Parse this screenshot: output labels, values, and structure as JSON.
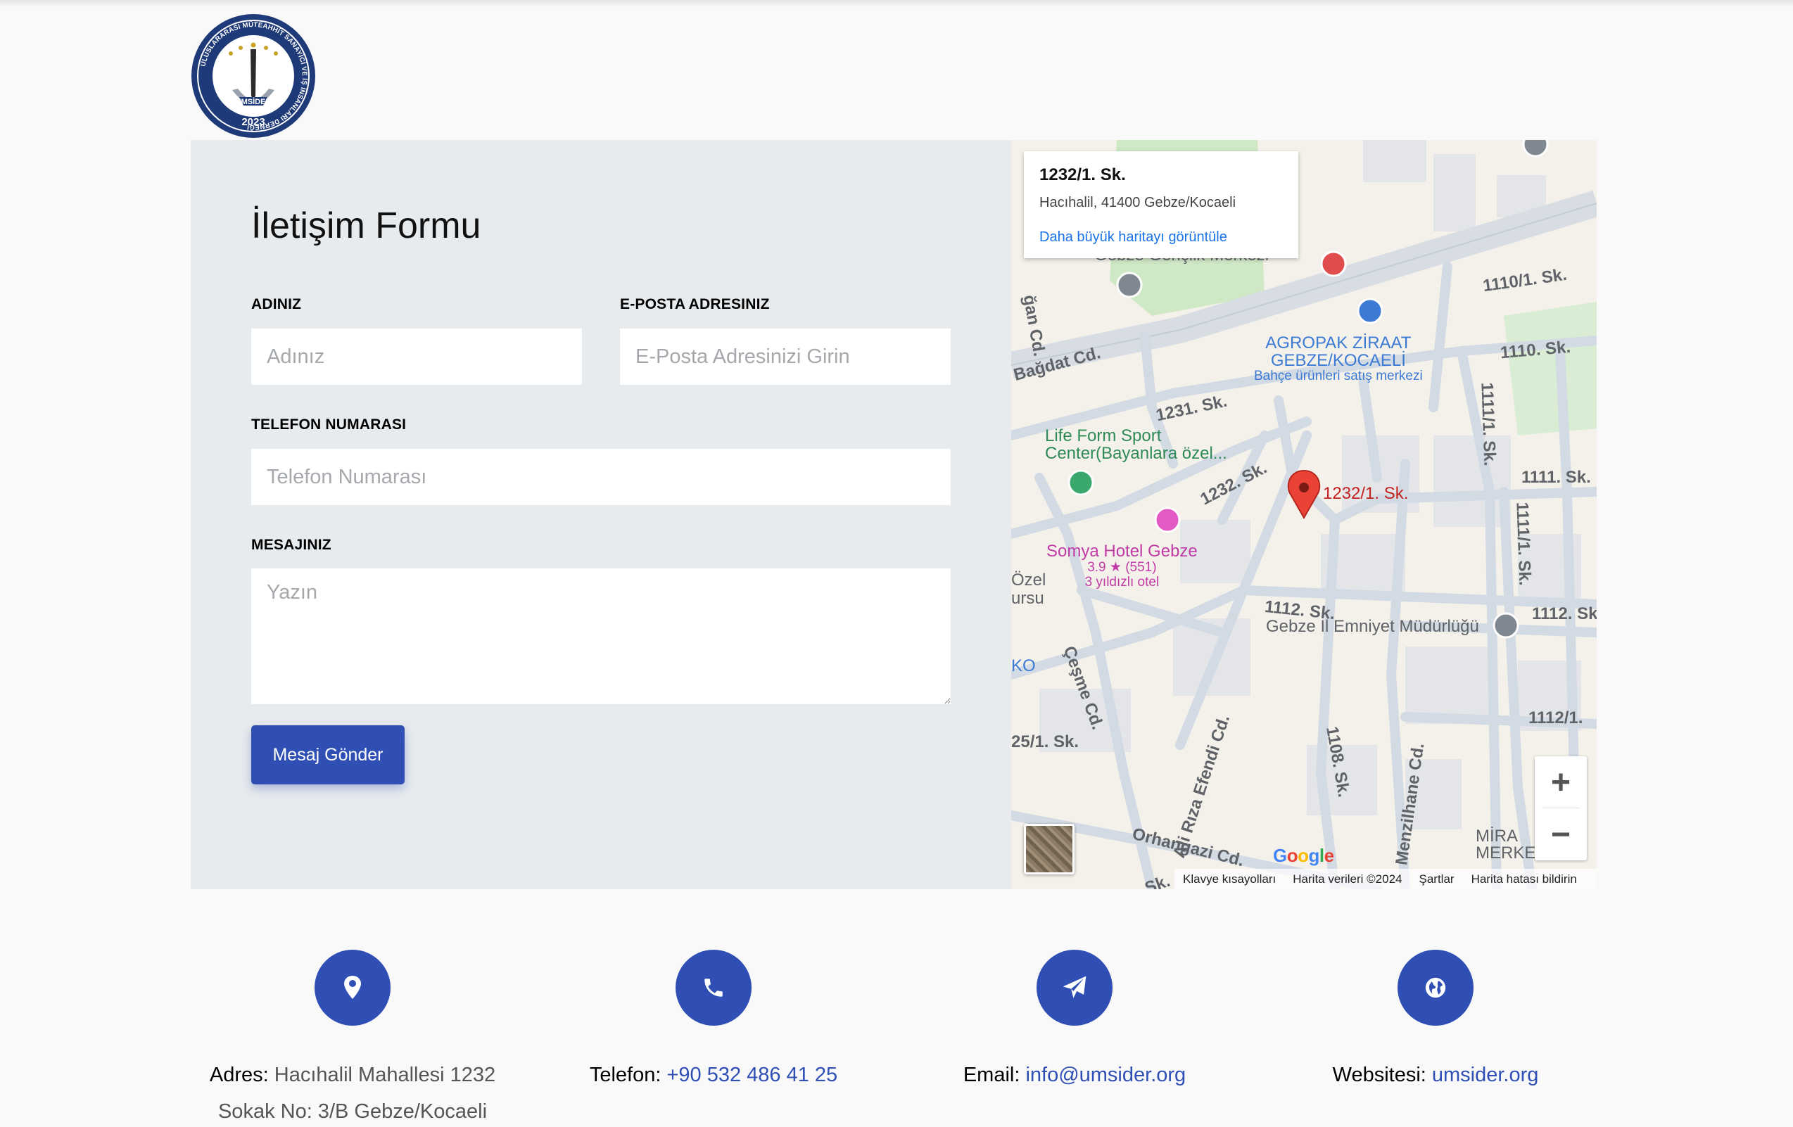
{
  "logo": {
    "ring_text": "ULUSLARARASI MÜTEAHHİT SANAYİCİ VE İŞ İNSANLARI DERNEĞİ",
    "name": "UMSİDER",
    "year": "2023"
  },
  "form": {
    "title": "İletişim Formu",
    "name_label": "ADINIZ",
    "name_placeholder": "Adınız",
    "email_label": "E-POSTA ADRESINIZ",
    "email_placeholder": "E-Posta Adresinizi Girin",
    "phone_label": "TELEFON NUMARASI",
    "phone_placeholder": "Telefon Numarası",
    "message_label": "MESAJINIZ",
    "message_placeholder": "Yazın",
    "submit_label": "Mesaj Gönder"
  },
  "map": {
    "card_title": "1232/1. Sk.",
    "card_address": "Hacıhalil, 41400 Gebze/Kocaeli",
    "card_link": "Daha büyük haritayı görüntüle",
    "marker_label": "1232/1. Sk.",
    "streets": {
      "s1110_1": "1110/1. Sk.",
      "s1110": "1110. Sk.",
      "bagdat": "Bağdat Cd.",
      "s1231": "1231. Sk.",
      "s1232": "1232. Sk.",
      "s1111": "1111. Sk.",
      "s1111_1a": "1111/1. Sk.",
      "s1111_1b": "1111/1. Sk.",
      "s1112": "1112. Sk.",
      "s1112_r": "1112. Sk",
      "s1112_1": "1112/1.",
      "cesme": "Çeşme Cd.",
      "alirza": "Ali Rıza Efendi Cd.",
      "s1108": "1108. Sk.",
      "menzilhane": "Menzilhane Cd.",
      "orhangazi": "Orhangazi Cd.",
      "s25_1": "25/1. Sk.",
      "gan": "ğan Cd.",
      "ozel": "Özel",
      "ursu": "ursu",
      "ko": "KO",
      "sk_bottom": "Sk."
    },
    "pois": {
      "agropak_1": "AGROPAK ZİRAAT",
      "agropak_2": "GEBZE/KOCAELİ",
      "agropak_3": "Bahçe ürünleri satış merkezi",
      "lifeform_1": "Life Form Sport",
      "lifeform_2": "Center(Bayanlara özel...",
      "hotel_name": "Somya Hotel Gebze",
      "hotel_rating": "3.9 ★ (551)",
      "hotel_type": "3 yıldızlı otel",
      "emniyet": "Gebze İl Emniyet Müdürlüğü",
      "genclik": "Gebze Gençlik Merkezi",
      "mira_1": "MİRA",
      "mira_2": "MERKEZİ"
    },
    "zoom_in": "+",
    "zoom_out": "−",
    "google": [
      "G",
      "o",
      "o",
      "g",
      "l",
      "e"
    ],
    "attribution": {
      "shortcuts": "Klavye kısayolları",
      "data": "Harita verileri ©2024",
      "terms": "Şartlar",
      "report": "Harita hatası bildirin"
    }
  },
  "contacts": [
    {
      "icon": "location-pin-icon",
      "key": "Adres:",
      "value_1": " Hacıhalil Mahallesi 1232",
      "value_2": "Sokak No: 3/B Gebze/Kocaeli"
    },
    {
      "icon": "phone-icon",
      "key": "Telefon:",
      "value": "+90 532 486 41 25"
    },
    {
      "icon": "paper-plane-icon",
      "key": "Email:",
      "value": "info@umsider.org"
    },
    {
      "icon": "globe-icon",
      "key": "Websitesi:",
      "value": "umsider.org"
    }
  ],
  "colors": {
    "accent": "#2f4fb5",
    "panel_bg": "#e8ebee",
    "page_bg": "#f9f9f9",
    "link_blue": "#1a73e8",
    "map_marker": "#ea4335"
  }
}
